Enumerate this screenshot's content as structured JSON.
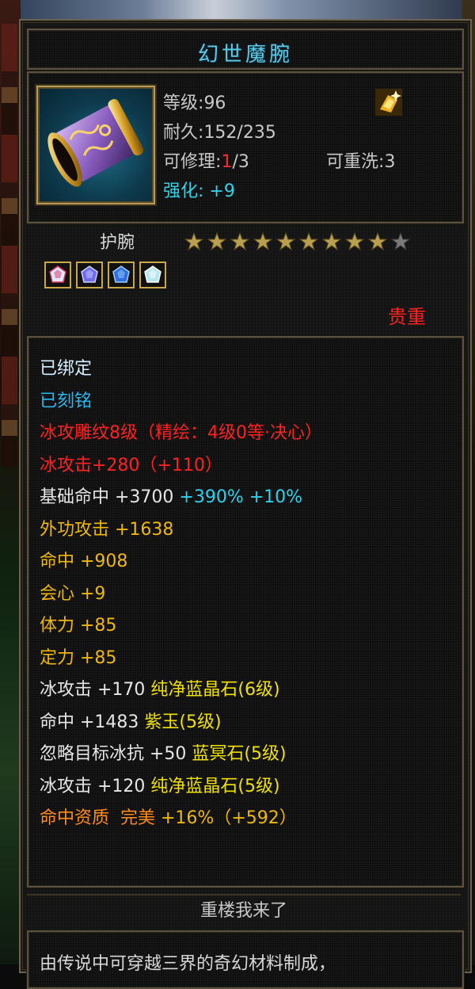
{
  "item": {
    "name": "幻世魔腕",
    "level_label": "等级",
    "level": "96",
    "durability_label": "耐久",
    "durability": "152/235",
    "repair_label": "可修理",
    "repair_used": "1",
    "repair_total": "/3",
    "rewash_label": "可重洗",
    "rewash": "3",
    "enhance_label": "强化",
    "enhance": "+9",
    "type": "护腕",
    "stars_filled": 9,
    "stars_total": 10,
    "rarity": "贵重"
  },
  "gems": [
    {
      "name": "gem-slot-1",
      "color": "#dfe8ff",
      "accent": "#e0305a"
    },
    {
      "name": "gem-slot-2",
      "color": "#6c6cf0",
      "accent": "#d0d0ff"
    },
    {
      "name": "gem-slot-3",
      "color": "#2f6fe0",
      "accent": "#9fd0ff"
    },
    {
      "name": "gem-slot-4",
      "color": "#b6e6ee",
      "accent": "#ffffff"
    }
  ],
  "attributes": [
    {
      "segments": [
        {
          "text": "已绑定",
          "color": "#d6f0ff"
        }
      ]
    },
    {
      "segments": [
        {
          "text": "已刻铭",
          "color": "#28b8f0"
        }
      ]
    },
    {
      "segments": [
        {
          "text": "冰攻雕纹8级（精绘：4级0等·决心）",
          "color": "#ff2020"
        }
      ]
    },
    {
      "segments": [
        {
          "text": "冰攻击+280（+110）",
          "color": "#ff2020"
        }
      ]
    },
    {
      "segments": [
        {
          "text": "基础命中 +3700 ",
          "color": "#e6e6e6"
        },
        {
          "text": "+390% +10%",
          "color": "#28d4f0"
        }
      ]
    },
    {
      "segments": [
        {
          "text": "外功攻击 +1638",
          "color": "#f0b800"
        }
      ]
    },
    {
      "segments": [
        {
          "text": "命中 +908",
          "color": "#f0b800"
        }
      ]
    },
    {
      "segments": [
        {
          "text": "会心 +9",
          "color": "#f0b800"
        }
      ]
    },
    {
      "segments": [
        {
          "text": "体力 +85",
          "color": "#f0b800"
        }
      ]
    },
    {
      "segments": [
        {
          "text": "定力 +85",
          "color": "#f0b800"
        }
      ]
    },
    {
      "segments": [
        {
          "text": "冰攻击 +170 ",
          "color": "#e6e6e6"
        },
        {
          "text": "纯净蓝晶石(6级)",
          "color": "#f0e000"
        }
      ]
    },
    {
      "segments": [
        {
          "text": "命中 +1483 ",
          "color": "#e6e6e6"
        },
        {
          "text": "紫玉(5级)",
          "color": "#f0e000"
        }
      ]
    },
    {
      "segments": [
        {
          "text": "忽略目标冰抗 +50 ",
          "color": "#e6e6e6"
        },
        {
          "text": "蓝冥石(5级)",
          "color": "#f0e000"
        }
      ]
    },
    {
      "segments": [
        {
          "text": "冰攻击 +120 ",
          "color": "#e6e6e6"
        },
        {
          "text": "纯净蓝晶石(5级)",
          "color": "#f0e000"
        }
      ]
    },
    {
      "segments": [
        {
          "text": "命中资质  ",
          "color": "#ff8c1a"
        },
        {
          "text": "完美 ",
          "color": "#ff8c1a"
        },
        {
          "text": "+16%（+592）",
          "color": "#f0b800"
        }
      ]
    }
  ],
  "footer": "重楼我来了",
  "description": "由传说中可穿越三界的奇幻材料制成，"
}
